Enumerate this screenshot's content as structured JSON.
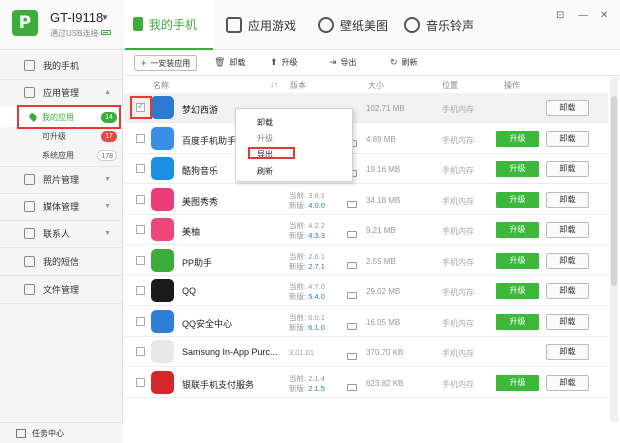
{
  "device": {
    "name": "GT-I9118",
    "connection": "通过USB连接",
    "logo_letter": "P"
  },
  "tabs": [
    {
      "label": "我的手机",
      "active": true
    },
    {
      "label": "应用游戏"
    },
    {
      "label": "壁纸美图"
    },
    {
      "label": "音乐铃声"
    }
  ],
  "window_controls": {
    "skin": "⊡",
    "minimize": "—",
    "close": "✕"
  },
  "sidebar": {
    "my_phone": "我的手机",
    "app_mgmt": "应用管理",
    "my_apps": {
      "label": "我的应用",
      "count": "14"
    },
    "upgradable": {
      "label": "可升级",
      "count": "17"
    },
    "system_apps": {
      "label": "系统应用",
      "count": "178"
    },
    "photo_mgmt": "照片管理",
    "media_mgmt": "媒体管理",
    "contacts": "联系人",
    "sms": "我的短信",
    "file_mgmt": "文件管理",
    "task_center": "任务中心"
  },
  "toolbar": {
    "install": "一安装应用",
    "uninstall": "卸载",
    "upgrade": "升级",
    "export": "导出",
    "refresh": "刷新"
  },
  "table_header": {
    "name": "名称",
    "version": "版本",
    "size": "大小",
    "location": "位置",
    "action": "操作"
  },
  "labels": {
    "current": "当前:",
    "new": "新版:",
    "update_btn": "升级",
    "uninstall_btn": "卸载"
  },
  "apps": [
    {
      "name": "梦幻西游",
      "current": "",
      "new": "",
      "size": "102.71 MB",
      "location": "手机内存",
      "update": false,
      "checked": true,
      "color": "#2b7ad0"
    },
    {
      "name": "百度手机助手",
      "current": "",
      "new": "",
      "size": "4.89 MB",
      "location": "手机内存",
      "update": true,
      "color": "#3a8ee6"
    },
    {
      "name": "酷狗音乐",
      "current": "",
      "new": "",
      "size": "19.16 MB",
      "location": "手机内存",
      "update": true,
      "color": "#1a8fe3"
    },
    {
      "name": "美图秀秀",
      "current": "3.8.1",
      "new": "4.0.0",
      "size": "34.18 MB",
      "location": "手机内存",
      "update": true,
      "color": "#ec3d7a"
    },
    {
      "name": "美柚",
      "current": "4.2.2",
      "new": "4.3.3",
      "size": "9.21 MB",
      "location": "手机内存",
      "update": true,
      "color": "#f0467c"
    },
    {
      "name": "PP助手",
      "current": "2.6.1",
      "new": "2.7.1",
      "size": "2.55 MB",
      "location": "手机内存",
      "update": true,
      "color": "#3cac3a"
    },
    {
      "name": "QQ",
      "current": "4.7.0",
      "new": "5.4.0",
      "size": "29.02 MB",
      "location": "手机内存",
      "update": true,
      "color": "#1b1b1b"
    },
    {
      "name": "QQ安全中心",
      "current": "6.0.1",
      "new": "6.1.0",
      "size": "16.05 MB",
      "location": "手机内存",
      "update": true,
      "color": "#2e7fd8"
    },
    {
      "name": "Samsung In-App Purc...",
      "current": "3.01.01",
      "new": "",
      "size": "370.70 KB",
      "location": "手机内存",
      "update": false,
      "color": "#e8e8e8"
    },
    {
      "name": "银联手机支付服务",
      "current": "2.1.4",
      "new": "2.1.5",
      "size": "623.82 KB",
      "location": "手机内存",
      "update": true,
      "color": "#d4272b"
    }
  ],
  "context_menu": {
    "uninstall": "卸载",
    "upgrade": "升级",
    "export": "导出",
    "refresh": "刷新"
  }
}
